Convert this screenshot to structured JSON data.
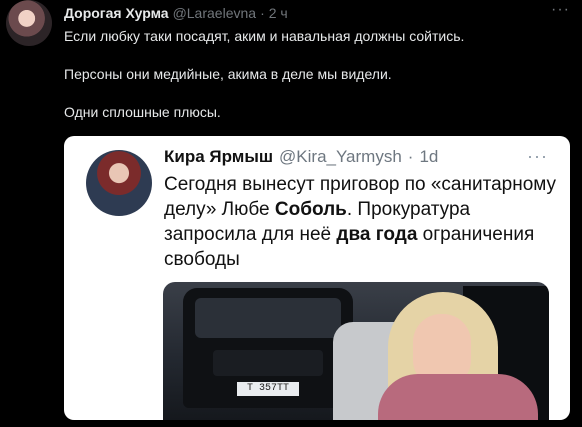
{
  "tweet": {
    "author_name": "Дорогая Хурма",
    "author_handle": "@Laraelevna",
    "separator": "·",
    "time": "2 ч",
    "more": "···",
    "lines": [
      "Если любку таки посадят, аким и навальная должны сойтись.",
      "Персоны они медийные, акима в деле мы видели.",
      "Одни сплошные плюсы."
    ]
  },
  "quote": {
    "author_name": "Кира Ярмыш",
    "author_handle": "@Kira_Yarmysh",
    "separator": "·",
    "time": "1d",
    "more": "···",
    "text_1": "Сегодня вынесут приговор по «санитарному делу» Любе ",
    "bold_1": "Соболь",
    "text_2": ". Прокуратура запросила для неё ",
    "bold_2": "два года",
    "text_3": " ограничения свободы",
    "photo_plate": "Т 357ТТ"
  }
}
